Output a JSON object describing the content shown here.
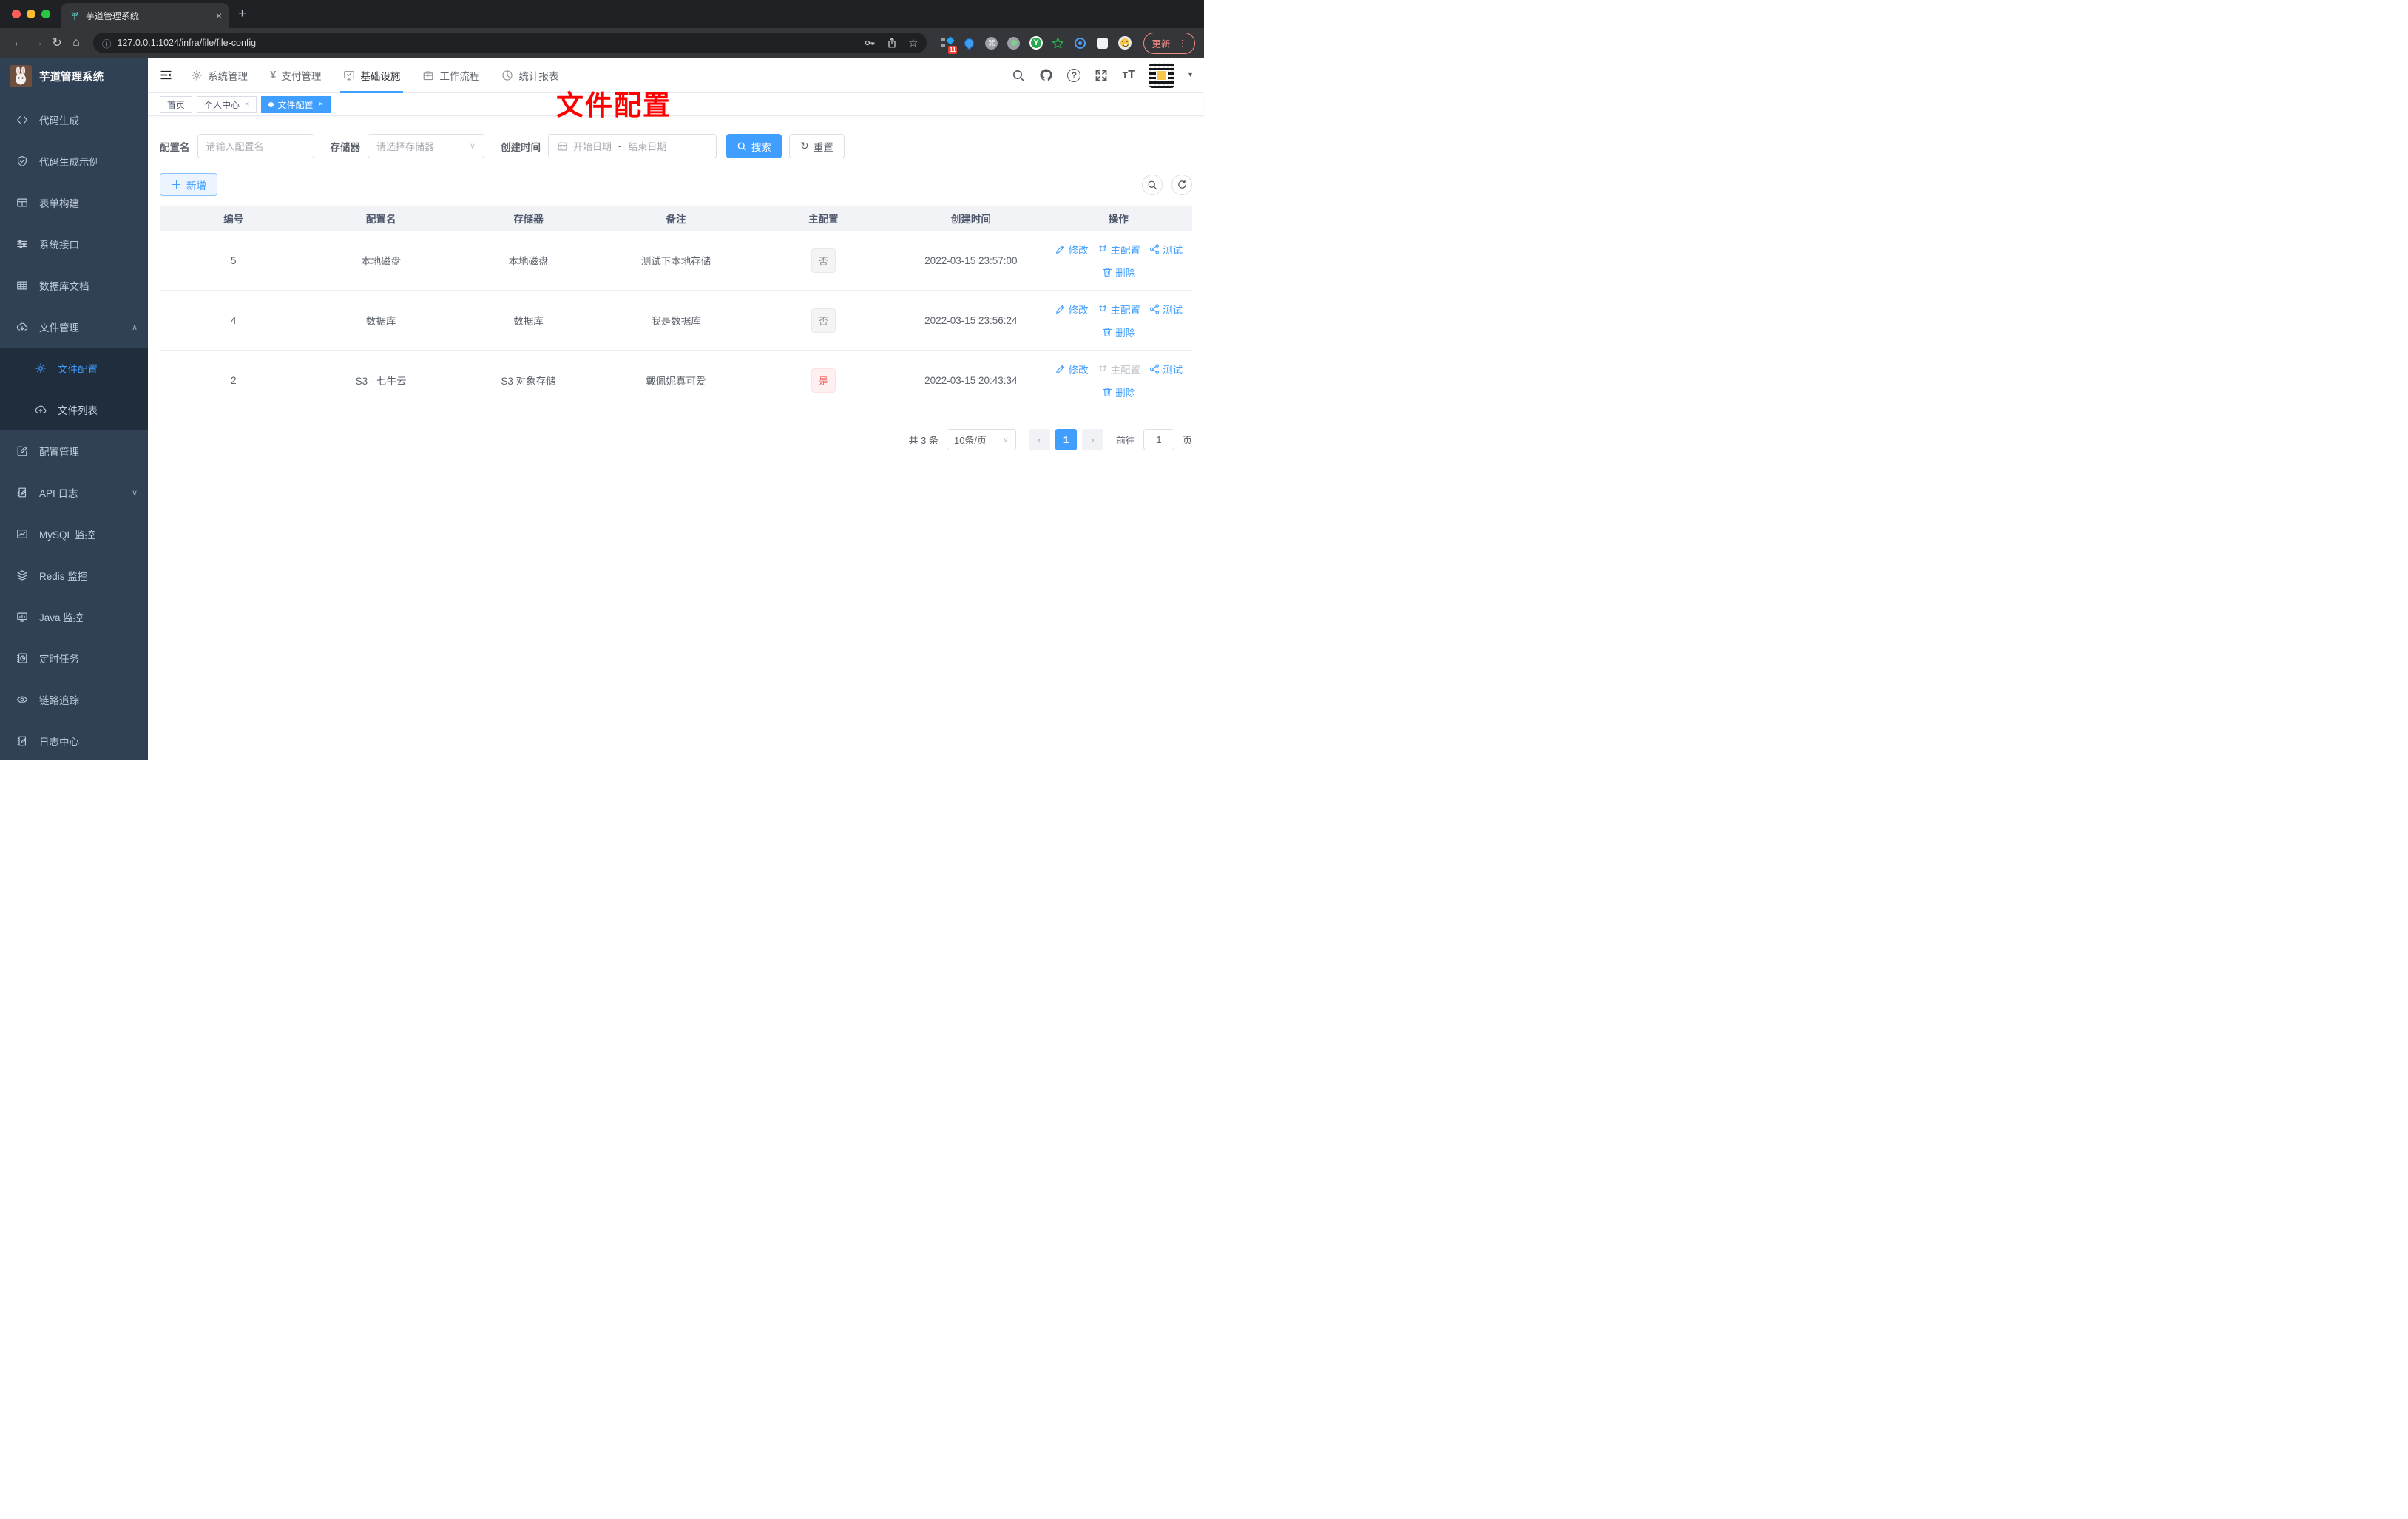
{
  "browser": {
    "tab_title": "芋道管理系统",
    "url": "127.0.0.1:1024/infra/file/file-config",
    "update_label": "更新",
    "extension_badge": "11"
  },
  "app": {
    "title": "芋道管理系统"
  },
  "sidebar": {
    "items": [
      {
        "id": "code-gen",
        "label": "代码生成",
        "icon": "code-icon"
      },
      {
        "id": "code-example",
        "label": "代码生成示例",
        "icon": "shield-check-icon"
      },
      {
        "id": "form-builder",
        "label": "表单构建",
        "icon": "form-icon"
      },
      {
        "id": "system-api",
        "label": "系统接口",
        "icon": "sliders-icon"
      },
      {
        "id": "db-doc",
        "label": "数据库文档",
        "icon": "grid-icon"
      },
      {
        "id": "file-manage",
        "label": "文件管理",
        "icon": "cloud-download-icon",
        "arrow": "up"
      },
      {
        "id": "file-config",
        "label": "文件配置",
        "icon": "gear-icon",
        "sub": true,
        "active": true
      },
      {
        "id": "file-list",
        "label": "文件列表",
        "icon": "cloud-upload-icon",
        "sub": true
      },
      {
        "id": "config-manage",
        "label": "配置管理",
        "icon": "edit-square-icon"
      },
      {
        "id": "api-log",
        "label": "API 日志",
        "icon": "log-icon",
        "arrow": "down"
      },
      {
        "id": "mysql-monitor",
        "label": "MySQL 监控",
        "icon": "chart-icon"
      },
      {
        "id": "redis-monitor",
        "label": "Redis 监控",
        "icon": "layers-icon"
      },
      {
        "id": "java-monitor",
        "label": "Java 监控",
        "icon": "monitor-icon"
      },
      {
        "id": "job",
        "label": "定时任务",
        "icon": "timer-icon"
      },
      {
        "id": "tracer",
        "label": "链路追踪",
        "icon": "eye-icon"
      },
      {
        "id": "log-center",
        "label": "日志中心",
        "icon": "log-icon"
      }
    ]
  },
  "topnav": {
    "items": [
      {
        "id": "system",
        "label": "系统管理",
        "icon": "gear-icon"
      },
      {
        "id": "pay",
        "label": "支付管理",
        "icon": "yen-icon"
      },
      {
        "id": "infra",
        "label": "基础设施",
        "icon": "infra-icon",
        "active": true
      },
      {
        "id": "workflow",
        "label": "工作流程",
        "icon": "briefcase-icon"
      },
      {
        "id": "report",
        "label": "统计报表",
        "icon": "stats-icon"
      }
    ]
  },
  "tags": [
    {
      "label": "首页",
      "closable": false,
      "active": false
    },
    {
      "label": "个人中心",
      "closable": true,
      "active": false
    },
    {
      "label": "文件配置",
      "closable": true,
      "active": true
    }
  ],
  "annotation": {
    "text": "文件配置",
    "color": "#fe0000"
  },
  "filters": {
    "config_name_label": "配置名",
    "config_name_placeholder": "请输入配置名",
    "storage_label": "存储器",
    "storage_placeholder": "请选择存储器",
    "create_time_label": "创建时间",
    "start_placeholder": "开始日期",
    "separator": "-",
    "end_placeholder": "结束日期",
    "search_label": "搜索",
    "reset_label": "重置",
    "add_label": "新增"
  },
  "table": {
    "columns": [
      "编号",
      "配置名",
      "存储器",
      "备注",
      "主配置",
      "创建时间",
      "操作"
    ],
    "actions": {
      "edit": "修改",
      "master": "主配置",
      "test": "测试",
      "delete": "删除"
    },
    "rows": [
      {
        "id": "5",
        "name": "本地磁盘",
        "storage": "本地磁盘",
        "remark": "测试下本地存储",
        "master": "否",
        "master_type": "info",
        "master_disabled": false,
        "time": "2022-03-15 23:57:00"
      },
      {
        "id": "4",
        "name": "数据库",
        "storage": "数据库",
        "remark": "我是数据库",
        "master": "否",
        "master_type": "info",
        "master_disabled": false,
        "time": "2022-03-15 23:56:24"
      },
      {
        "id": "2",
        "name": "S3 - 七牛云",
        "storage": "S3 对象存储",
        "remark": "戴佩妮真可爱",
        "master": "是",
        "master_type": "danger",
        "master_disabled": true,
        "time": "2022-03-15 20:43:34"
      }
    ]
  },
  "pagination": {
    "total": "共 3 条",
    "page_size": "10条/页",
    "prev": "‹",
    "current": "1",
    "next": "›",
    "goto_label": "前往",
    "goto_value": "1",
    "page_suffix": "页"
  }
}
